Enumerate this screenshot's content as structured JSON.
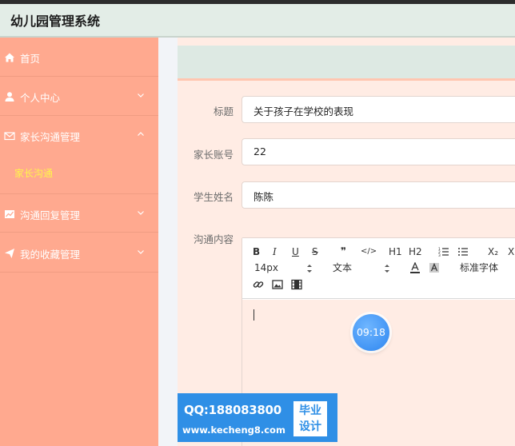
{
  "app": {
    "title": "幼儿园管理系统"
  },
  "sidebar": {
    "items": [
      {
        "label": "首页",
        "icon": "home-icon"
      },
      {
        "label": "个人中心",
        "icon": "user-icon",
        "chevron": "down"
      },
      {
        "label": "家长沟通管理",
        "icon": "mail-icon",
        "chevron": "up"
      },
      {
        "label": "沟通回复管理",
        "icon": "chart-icon",
        "chevron": "down"
      },
      {
        "label": "我的收藏管理",
        "icon": "send-icon",
        "chevron": "down"
      }
    ],
    "active_sub": {
      "label": "家长沟通"
    }
  },
  "form": {
    "title": {
      "label": "标题",
      "value": "关于孩子在学校的表现"
    },
    "account": {
      "label": "家长账号",
      "value": "22"
    },
    "student": {
      "label": "学生姓名",
      "value": "陈陈"
    },
    "content": {
      "label": "沟通内容"
    }
  },
  "editor": {
    "toolbar": {
      "bold": "B",
      "italic": "I",
      "underline": "U",
      "strike": "S",
      "quote": "❞",
      "code": "</>",
      "h1": "H1",
      "h2": "H2",
      "subscript": "X₂",
      "superscript": "X",
      "font_size": "14px",
      "paragraph": "文本",
      "font_family": "标准字体"
    }
  },
  "overlay": {
    "timer": "09:18"
  },
  "watermark": {
    "qq": "QQ:188083800",
    "url": "www.kecheng8.com",
    "badge_line1": "毕业",
    "badge_line2": "设计"
  },
  "colors": {
    "sidebar": "#ffa98f",
    "header": "#e3ede7",
    "content": "#ffece4",
    "active_sub": "#fff54a",
    "watermark": "#2f8fe6"
  }
}
